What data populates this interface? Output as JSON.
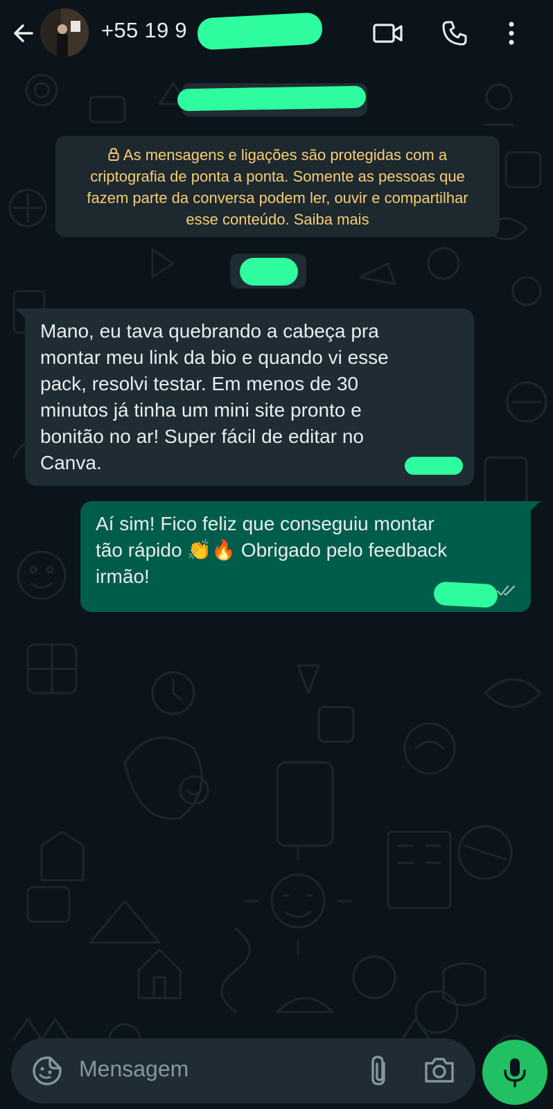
{
  "header": {
    "contact_name": "+55 19 9",
    "icons": [
      "back-arrow-icon",
      "video-call-icon",
      "phone-icon",
      "more-options-icon"
    ]
  },
  "date_chip": "",
  "encryption_notice": "As mensagens e ligações são protegidas com a criptografia de ponta a ponta. Somente as pessoas que fazem parte da conversa podem ler, ouvir e compartilhar esse conteúdo. Saiba mais",
  "messages": [
    {
      "direction": "incoming",
      "text": "Mano, eu tava quebrando a cabeça pra\nmontar meu link da bio e quando vi esse\npack, resolvi testar. Em menos de 30\nminutos já tinha um mini site pronto e\nbonitão no ar! Super fácil de editar no\nCanva.",
      "time": ""
    },
    {
      "direction": "outgoing",
      "text": "Aí sim! Fico feliz que conseguiu montar\ntão rápido 👏🔥 Obrigado pelo feedback\nirmão!",
      "time": "",
      "status": "read-ticks-icon"
    }
  ],
  "input": {
    "placeholder": "Mensagem"
  },
  "colors": {
    "background": "#0b141a",
    "incoming_bubble": "#1f2c33",
    "outgoing_bubble": "#005c4b",
    "notice_text": "#f7cd73",
    "mic_button": "#21c063",
    "redaction": "#2efc9e"
  }
}
